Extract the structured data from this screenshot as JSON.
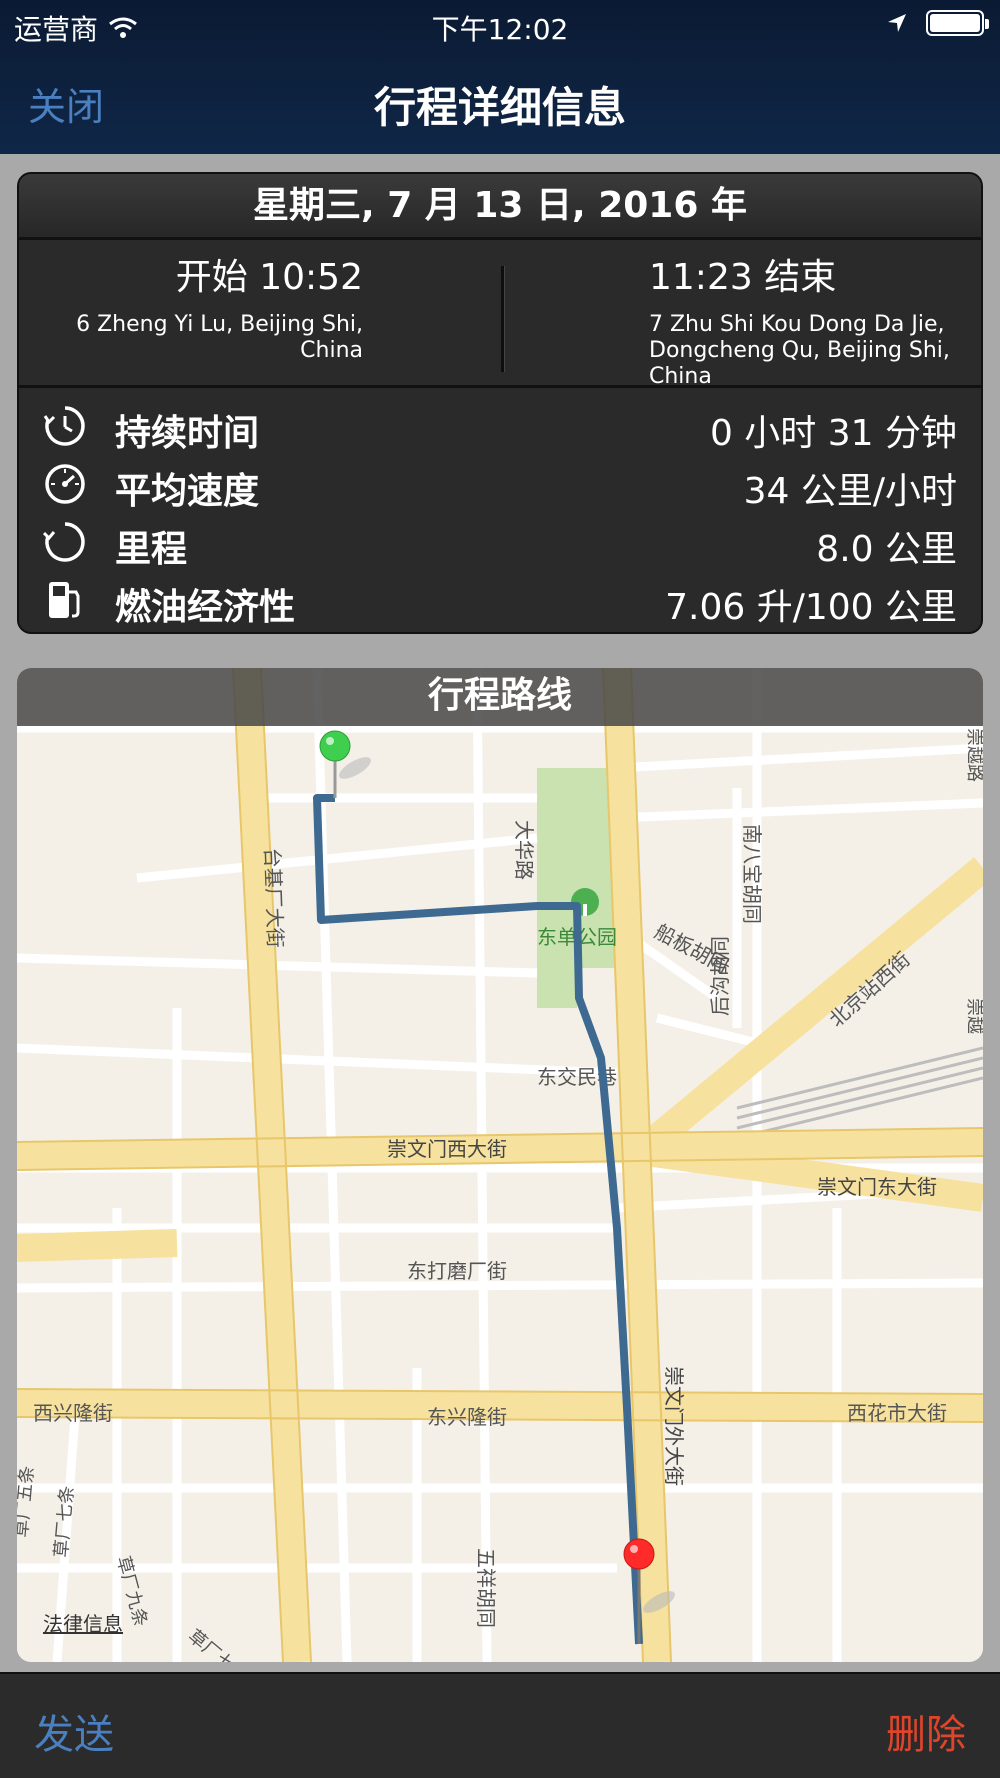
{
  "status_bar": {
    "carrier": "运营商",
    "time": "下午12:02"
  },
  "nav": {
    "close_label": "关闭",
    "title": "行程详细信息"
  },
  "trip": {
    "date": "星期三, 7 月 13 日, 2016 年",
    "start_time": "开始 10:52",
    "start_address": "6 Zheng Yi Lu, Beijing Shi, China",
    "end_time": "11:23 结束",
    "end_address": "7 Zhu Shi Kou Dong Da Jie, Dongcheng Qu, Beijing Shi, China"
  },
  "stats": [
    {
      "icon": "duration-icon",
      "label": "持续时间",
      "value": "0 小时 31 分钟"
    },
    {
      "icon": "speedometer-icon",
      "label": "平均速度",
      "value": "34 公里/小时"
    },
    {
      "icon": "odometer-icon",
      "label": "里程",
      "value": "8.0 公里"
    },
    {
      "icon": "fuel-pump-icon",
      "label": "燃油经济性",
      "value": "7.06 升/100 公里"
    }
  ],
  "map": {
    "title": "行程路线",
    "legal": "法律信息",
    "labels": {
      "taiji": "台基厂大街",
      "dahua": "大华路",
      "park": "东单公园",
      "nanbao": "南八宝胡同",
      "chuanban": "船板胡同",
      "houguo": "后沟胡同",
      "beijingzhan": "北京站西街",
      "dongjiao": "东交民巷",
      "chongwen_west": "崇文门西大街",
      "chongwen_east": "崇文门东大街",
      "dongdamo": "东打磨厂街",
      "xixinglong": "西兴隆街",
      "dongxinglong": "东兴隆街",
      "xihuashi": "西花市大街",
      "chongwen_wai": "崇文门外大街",
      "wuxiang": "五祥胡同",
      "caochang5": "草厂五条",
      "caochang7": "草厂七条",
      "caochang9": "草厂九条",
      "caochang": "草厂七",
      "edge_top": "崇越路",
      "edge_mid": "崇越"
    },
    "start_pin_color": "#3fcf4f",
    "end_pin_color": "#ff2a2a",
    "route_color": "#3e6a92"
  },
  "bottom": {
    "send_label": "发送",
    "delete_label": "删除"
  },
  "colors": {
    "link_blue": "#4a7fc0",
    "delete_red": "#e0452b"
  }
}
